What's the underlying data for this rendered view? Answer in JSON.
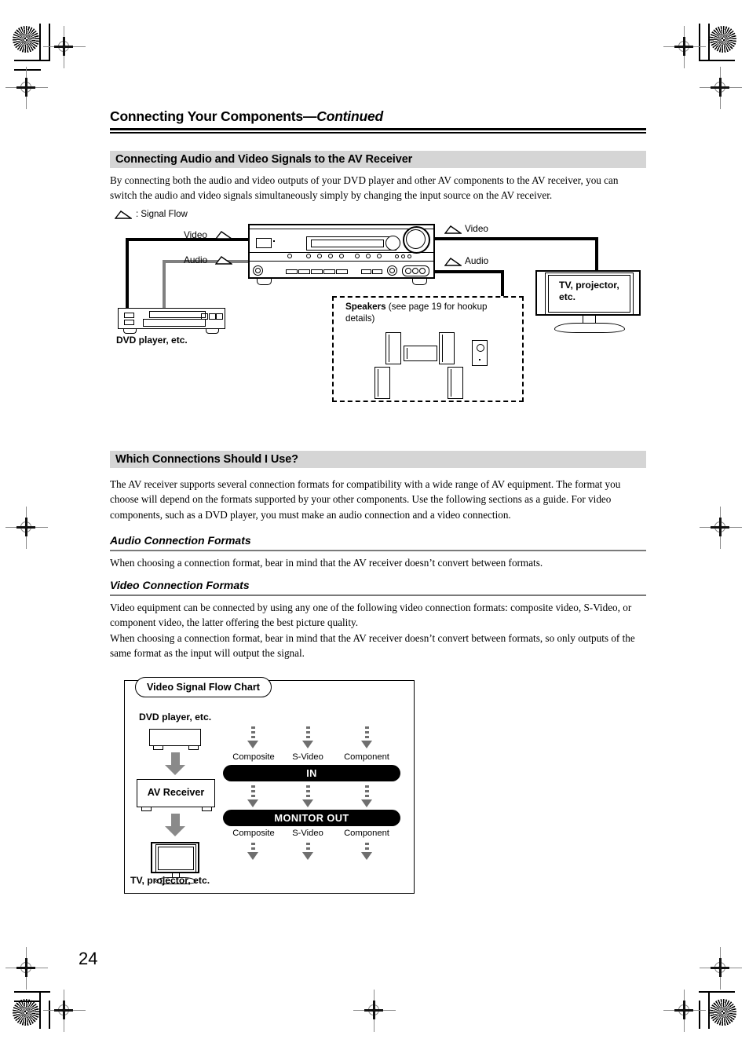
{
  "document": {
    "title_main": "Connecting Your Components",
    "title_dash": "—",
    "title_cont": "Continued",
    "page_number": "24"
  },
  "section1": {
    "heading": "Connecting Audio and Video Signals to the AV Receiver",
    "paragraph": "By connecting both the audio and video outputs of your DVD player and other AV components to the AV receiver, you can switch the audio and video signals simultaneously simply by changing the input source on the AV receiver."
  },
  "diagram1": {
    "legend": ": Signal Flow",
    "label_video_left": "Video",
    "label_audio_left": "Audio",
    "label_video_right": "Video",
    "label_audio_right": "Audio",
    "dvd_label": "DVD player, etc.",
    "tv_label": "TV, projector,\netc.",
    "tv_label_line1": "TV, projector,",
    "tv_label_line2": "etc.",
    "speakers_bold": "Speakers",
    "speakers_rest": " (see page 19 for hookup details)"
  },
  "section2": {
    "heading": "Which Connections Should I Use?",
    "paragraph": "The AV receiver supports several connection formats for compatibility with a wide range of AV equipment. The format you choose will depend on the formats supported by your other components. Use the following sections as a guide. For video components, such as a DVD player, you must make an audio connection and a video connection.",
    "audio_subhead": "Audio Connection Formats",
    "audio_paragraph": "When choosing a connection format, bear in mind that the AV receiver doesn’t convert between formats.",
    "video_subhead": "Video Connection Formats",
    "video_paragraph1": "Video equipment can be connected by using any one of the following video connection formats: composite video, S-Video, or component video, the latter offering the best picture quality.",
    "video_paragraph2": "When choosing a connection format, bear in mind that the AV receiver doesn’t convert between formats, so only outputs of the same format as the input will output the signal."
  },
  "flowchart": {
    "tag": "Video Signal Flow Chart",
    "source_label": "DVD player, etc.",
    "receiver_label": "AV Receiver",
    "sink_label": "TV, projector, etc.",
    "in_pill": "IN",
    "out_pill": "MONITOR OUT",
    "formats_top": [
      "Composite",
      "S-Video",
      "Component"
    ],
    "formats_bottom": [
      "Composite",
      "S-Video",
      "Component"
    ]
  },
  "chart_data": {
    "type": "diagram",
    "title": "Video Signal Flow Chart",
    "nodes": [
      "DVD player, etc.",
      "AV Receiver",
      "TV, projector, etc."
    ],
    "stages": [
      "IN",
      "MONITOR OUT"
    ],
    "formats": [
      "Composite",
      "S-Video",
      "Component"
    ]
  },
  "colors": {
    "section_bar": "#d5d5d5",
    "pill": "#000000",
    "arrow_gray": "#6f6f6f",
    "big_arrow_gray": "#8a8a8a",
    "audio_wire": "#808080",
    "video_wire": "#000000"
  }
}
